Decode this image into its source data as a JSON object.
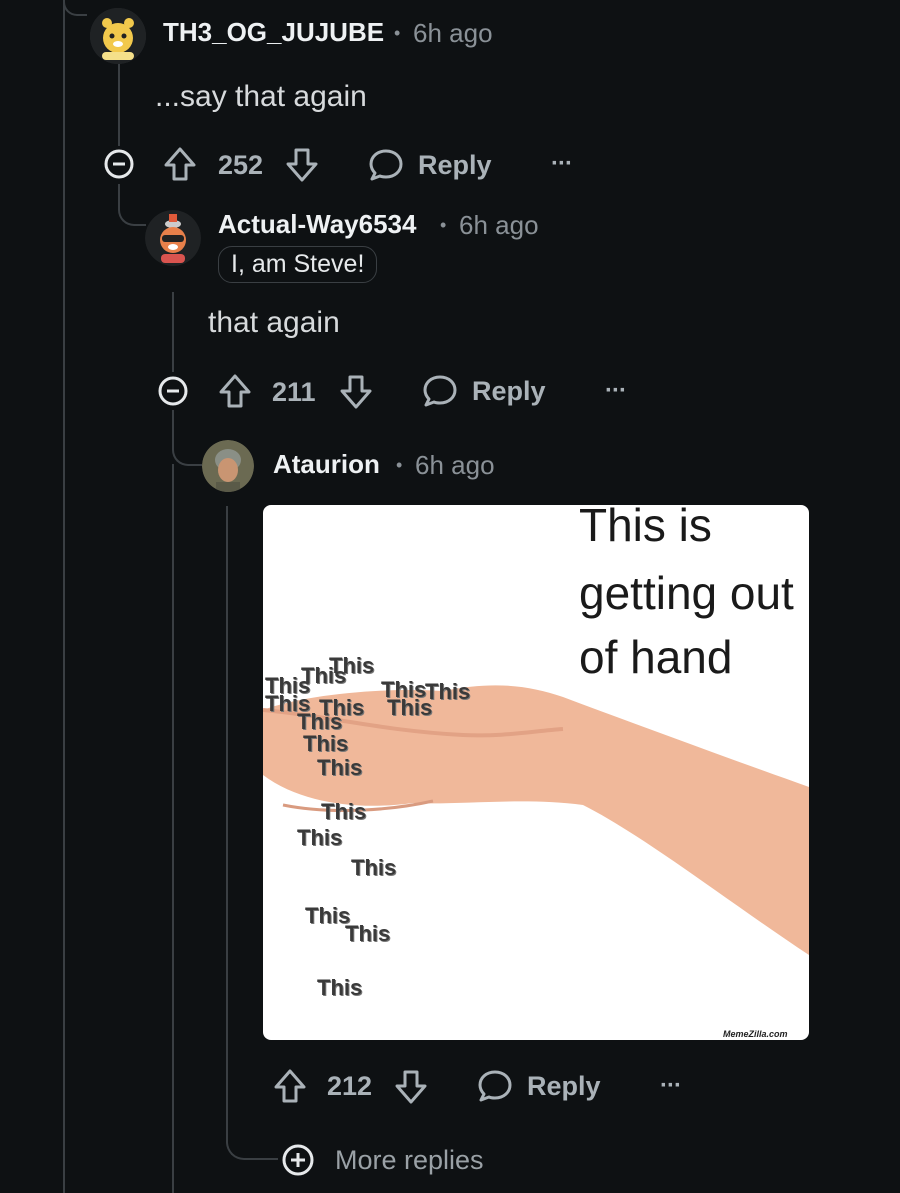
{
  "comments": [
    {
      "username": "TH3_OG_JUJUBE",
      "time": "6h ago",
      "text": "...say that again",
      "votes": "252",
      "reply_label": "Reply",
      "more_label": "···"
    },
    {
      "username": "Actual-Way6534",
      "time": "6h ago",
      "flair": "I, am Steve!",
      "text": "that again",
      "votes": "211",
      "reply_label": "Reply",
      "more_label": "···"
    },
    {
      "username": "Ataurion",
      "time": "6h ago",
      "votes": "212",
      "reply_label": "Reply",
      "more_label": "···",
      "image": {
        "caption_lines": [
          "This is",
          "getting out",
          "of hand"
        ],
        "this_word": "This",
        "watermark": "MemeZilla.com"
      }
    }
  ],
  "more_replies_label": "More replies",
  "separator": "•",
  "colors": {
    "background": "#0e1113",
    "thread_line": "#3a3f43",
    "username": "#eef1f3",
    "meta": "#8a9197"
  },
  "icons": [
    "collapse-icon",
    "upvote-icon",
    "downvote-icon",
    "reply-bubble-icon",
    "more-options-icon",
    "add-circle-icon"
  ]
}
